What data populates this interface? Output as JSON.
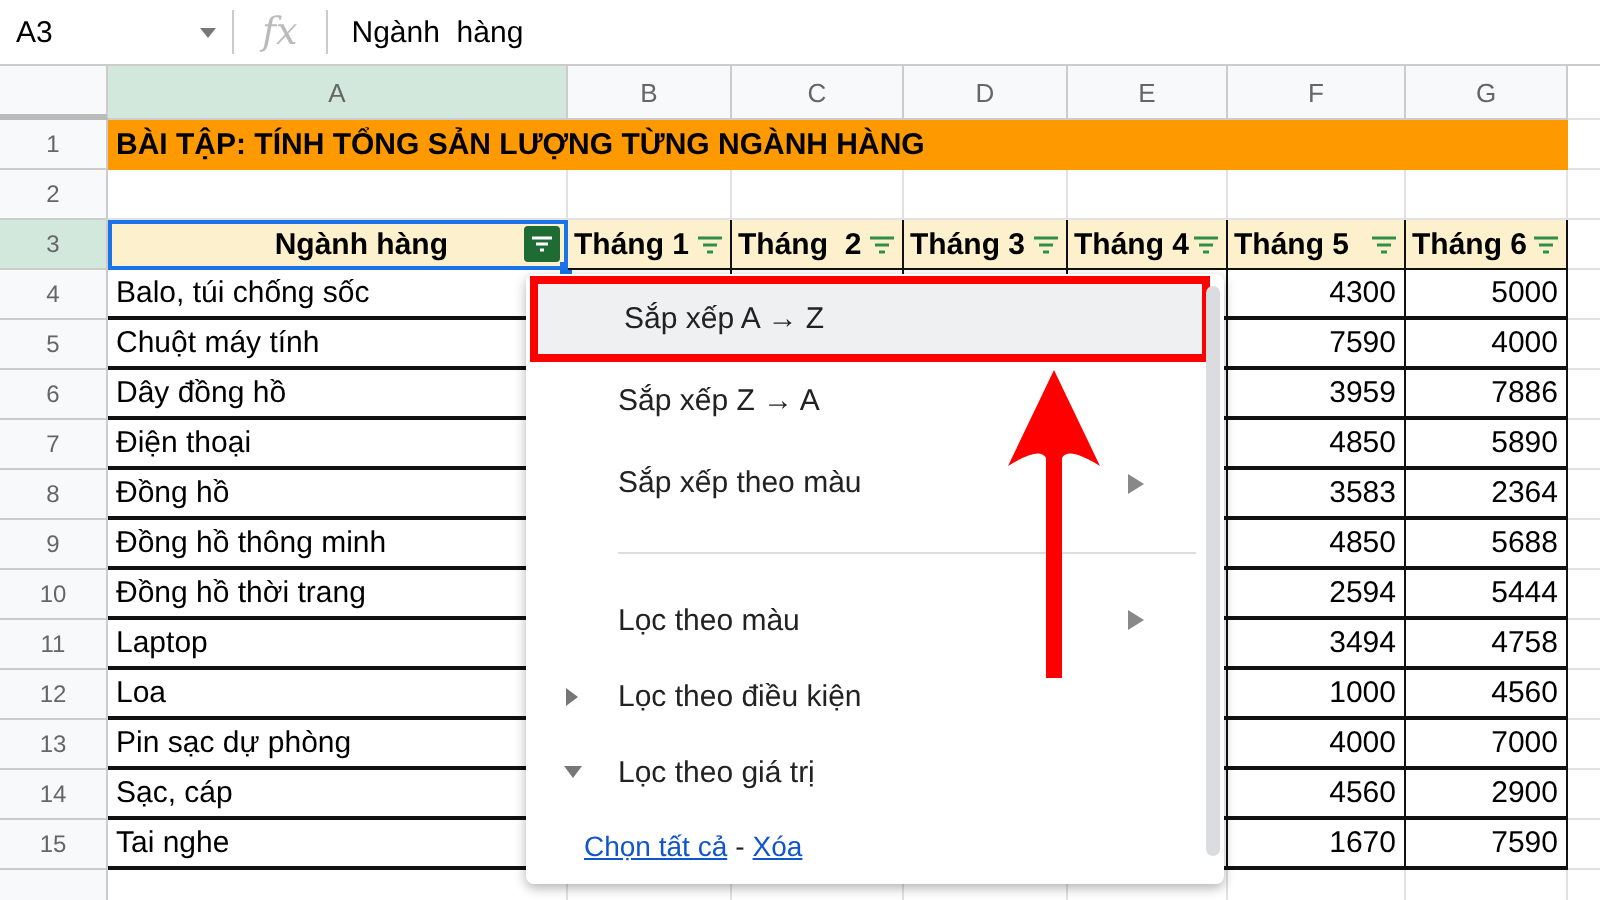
{
  "formula_bar": {
    "cell_ref": "A3",
    "fx": "fx",
    "value": "Ngành  hàng"
  },
  "columns": [
    "A",
    "B",
    "C",
    "D",
    "E",
    "F",
    "G"
  ],
  "title_row": {
    "number": "1",
    "text": "BÀI TẬP: TÍNH TỔNG SẢN LƯỢNG TỪNG NGÀNH HÀNG"
  },
  "blank_row": {
    "number": "2"
  },
  "header_row": {
    "number": "3",
    "cells": [
      {
        "text": "Ngành hàng",
        "filter_active": true,
        "selected": true
      },
      {
        "text": "Tháng 1",
        "filter_active": false,
        "selected": false
      },
      {
        "text": "Tháng  2",
        "filter_active": false,
        "selected": false
      },
      {
        "text": "Tháng 3",
        "filter_active": false,
        "selected": false
      },
      {
        "text": "Tháng 4",
        "filter_active": false,
        "selected": false
      },
      {
        "text": "Tháng 5",
        "filter_active": false,
        "selected": false
      },
      {
        "text": "Tháng 6",
        "filter_active": false,
        "selected": false
      }
    ]
  },
  "data_rows": [
    {
      "number": "4",
      "column_a": "Balo, túi chống sốc",
      "column_f": "4300",
      "column_g": "5000"
    },
    {
      "number": "5",
      "column_a": "Chuột máy tính",
      "column_f": "7590",
      "column_g": "4000"
    },
    {
      "number": "6",
      "column_a": "Dây đồng hồ",
      "column_f": "3959",
      "column_g": "7886"
    },
    {
      "number": "7",
      "column_a": "Điện thoại",
      "column_f": "4850",
      "column_g": "5890"
    },
    {
      "number": "8",
      "column_a": "Đồng hồ",
      "column_f": "3583",
      "column_g": "2364"
    },
    {
      "number": "9",
      "column_a": "Đồng hồ thông minh",
      "column_f": "4850",
      "column_g": "5688"
    },
    {
      "number": "10",
      "column_a": "Đồng hồ thời trang",
      "column_f": "2594",
      "column_g": "5444"
    },
    {
      "number": "11",
      "column_a": "Laptop",
      "column_f": "3494",
      "column_g": "4758"
    },
    {
      "number": "12",
      "column_a": "Loa",
      "column_f": "1000",
      "column_g": "4560"
    },
    {
      "number": "13",
      "column_a": "Pin sạc dự phòng",
      "column_f": "4000",
      "column_g": "7000"
    },
    {
      "number": "14",
      "column_a": "Sạc, cáp",
      "column_f": "4560",
      "column_g": "2900"
    },
    {
      "number": "15",
      "column_a": "Tai nghe",
      "column_f": "1670",
      "column_g": "7590"
    }
  ],
  "filter_menu": {
    "items": [
      {
        "kind": "action",
        "label": "Sắp xếp A → Z",
        "selected": true
      },
      {
        "kind": "action",
        "label": "Sắp xếp Z → A",
        "selected": false
      },
      {
        "kind": "submenu",
        "label": "Sắp xếp theo màu",
        "selected": false
      },
      {
        "kind": "separator"
      },
      {
        "kind": "submenu",
        "label": "Lọc theo màu",
        "selected": false
      },
      {
        "kind": "section",
        "label": "Lọc theo điều kiện",
        "expanded": false,
        "selected": false
      },
      {
        "kind": "section",
        "label": "Lọc theo giá trị",
        "expanded": true,
        "selected": false
      }
    ],
    "select_all_link": "Chọn tất cả",
    "link_separator": "-",
    "clear_link": "Xóa"
  },
  "annotations": {
    "frame_on_selected": true,
    "arrow": true
  }
}
